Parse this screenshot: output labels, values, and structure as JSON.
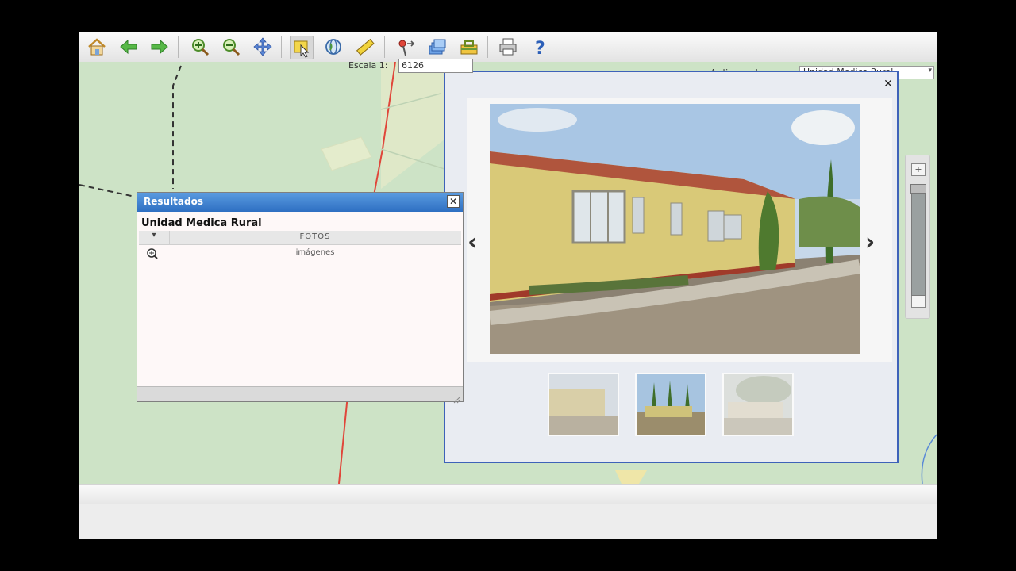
{
  "toolbar": {
    "buttons": [
      {
        "name": "home-icon",
        "glyph": "home"
      },
      {
        "name": "back-icon",
        "glyph": "arrow-left"
      },
      {
        "name": "forward-icon",
        "glyph": "arrow-right"
      },
      {
        "name": "zoom-in-icon",
        "glyph": "zoom-in"
      },
      {
        "name": "zoom-out-icon",
        "glyph": "zoom-out"
      },
      {
        "name": "pan-icon",
        "glyph": "pan"
      },
      {
        "name": "identify-icon",
        "glyph": "identify"
      },
      {
        "name": "globe-icon",
        "glyph": "globe"
      },
      {
        "name": "measure-icon",
        "glyph": "ruler"
      },
      {
        "name": "pin-icon",
        "glyph": "pin"
      },
      {
        "name": "layers-icon",
        "glyph": "layers"
      },
      {
        "name": "toolbox-icon",
        "glyph": "toolbox"
      },
      {
        "name": "print-icon",
        "glyph": "printer"
      },
      {
        "name": "help-icon",
        "glyph": "question"
      }
    ]
  },
  "layer_selector": {
    "label": "Aplicar a la capa:",
    "value": "Unidad Medica Rural"
  },
  "viewer": {
    "close": "✕",
    "prev": "‹",
    "next": "›"
  },
  "results": {
    "title": "Resultados",
    "close": "✕",
    "layer_name": "Unidad Medica Rural",
    "columns": [
      "",
      "FOTOS"
    ],
    "rows": [
      {
        "value": "imágenes"
      }
    ]
  },
  "status": {
    "scale_label": "Escala 1:",
    "scale_value": "6126"
  },
  "colors": {
    "map_background": "#cde3c6",
    "title_bar": "#2e6fc2",
    "viewer_border": "#3e62b9",
    "road_red": "#e0463a"
  }
}
